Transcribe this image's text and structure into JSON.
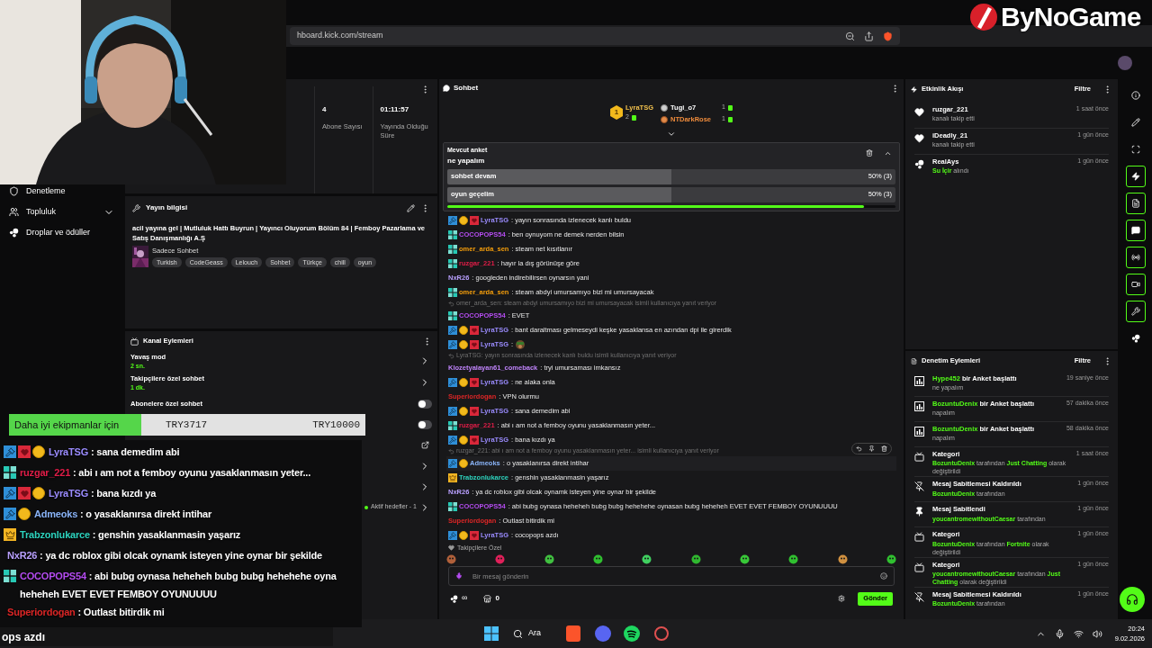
{
  "logo": {
    "text": "ByNoGame"
  },
  "browser": {
    "url": "hboard.kick.com/stream"
  },
  "sidebar": {
    "items": [
      {
        "label": "Denetleme"
      },
      {
        "label": "Topluluk",
        "expanded": true
      },
      {
        "label": "Droplar ve ödüller"
      }
    ]
  },
  "stats": [
    {
      "value": "4",
      "label": "Abone Sayısı"
    },
    {
      "value": "01:11:57",
      "label": "Yayında Olduğu Süre"
    }
  ],
  "stream_info": {
    "title": "Yayın bilgisi",
    "stream_title": "acil yayına gel | Mutluluk Hattı Buyrun | Yayıncı Oluyorum Bölüm 84 | Femboy Pazarlama ve Satış Danışmanlığı A.Ş",
    "category": "Sadece Sohbet",
    "tags": [
      "Turkish",
      "CodeGeass",
      "Lelouch",
      "Sohbet",
      "Türkçe",
      "chill",
      "oyun"
    ]
  },
  "channel_actions": {
    "title": "Kanal Eylemleri",
    "items": [
      {
        "kind": "chevron",
        "label": "Yavaş mod",
        "value": "2 sn."
      },
      {
        "kind": "chevron",
        "label": "Takipçilere özel sohbet",
        "value": "1 dk."
      },
      {
        "kind": "toggle",
        "label": "Abonelere özel sohbet",
        "on": false
      },
      {
        "kind": "toggle",
        "on": false
      },
      {
        "kind": "external"
      },
      {
        "kind": "chevron"
      },
      {
        "kind": "chevron"
      },
      {
        "kind": "chevron",
        "status": "Aktif hedefler - 1"
      }
    ]
  },
  "chat": {
    "title": "Sohbet",
    "leaders": [
      {
        "kind": "gold",
        "rank": "1",
        "name": "LyraTSG",
        "count": "2",
        "color": "#f2c14e"
      },
      {
        "kind": "silver",
        "name": "Tugi_o7",
        "count": "1",
        "color": "#ffffff"
      },
      {
        "kind": "bronze",
        "name": "NTDarkRose",
        "count": "1",
        "color": "#f08c3c"
      }
    ],
    "poll": {
      "label": "Mevcut anket",
      "question": "ne yapalım",
      "level": 0.93,
      "options": [
        {
          "text": "sohbet devam",
          "result": "50% (3)",
          "level": 0.5
        },
        {
          "text": "oyun geçelim",
          "result": "50% (3)",
          "level": 0.5
        }
      ]
    },
    "messages": [
      {
        "kind": "message",
        "badges": [
          {
            "kind": "mod"
          },
          {
            "kind": "sub"
          },
          {
            "kind": "vip"
          }
        ],
        "name": "LyraTSG",
        "color": "#9b8cff",
        "text": ": yayın sonrasında izlenecek kanlı buldu"
      },
      {
        "kind": "message",
        "badges": [
          {
            "kind": "og"
          }
        ],
        "name": "COCOPOPS54",
        "color": "#b44cf0",
        "text": ": ben oynuyom ne demek nerden bilsin"
      },
      {
        "kind": "message",
        "badges": [
          {
            "kind": "og"
          }
        ],
        "name": "omer_arda_sen",
        "color": "#f59e0b",
        "text": ": steam net kısıtlanır"
      },
      {
        "kind": "message",
        "badges": [
          {
            "kind": "og"
          }
        ],
        "name": "ruzgar_221",
        "color": "#e11d48",
        "text": ": hayır la dış görünüşe göre"
      },
      {
        "kind": "message",
        "name": "NxR26",
        "color": "#b9a0ff",
        "text": ": googleden indirebilirsen oynarsın yani"
      },
      {
        "kind": "message",
        "badges": [
          {
            "kind": "og"
          }
        ],
        "name": "omer_arda_sen",
        "color": "#f59e0b",
        "text": ": steam abdyi umursamıyo bizi mi umursayacak"
      },
      {
        "kind": "reply",
        "text": "omer_arda_sen: steam abdyi umursamıyo bizi mi umursayacak isimli kullanıcıya yanıt veriyor"
      },
      {
        "kind": "message",
        "badges": [
          {
            "kind": "og"
          }
        ],
        "name": "COCOPOPS54",
        "color": "#b44cf0",
        "text": ": EVET"
      },
      {
        "kind": "message",
        "badges": [
          {
            "kind": "mod"
          },
          {
            "kind": "sub"
          },
          {
            "kind": "vip"
          }
        ],
        "name": "LyraTSG",
        "color": "#9b8cff",
        "text": ": bant daraltması gelmeseydi keşke yasaklansa en azından dpi ile girerdik"
      },
      {
        "kind": "message",
        "badges": [
          {
            "kind": "mod"
          },
          {
            "kind": "sub"
          },
          {
            "kind": "vip"
          }
        ],
        "name": "LyraTSG",
        "color": "#9b8cff",
        "text": ":",
        "emote": true
      },
      {
        "kind": "reply",
        "text": "LyraTSG: yayın sonrasında izlenecek kanlı buldu isimli kullanıcıya yanıt veriyor"
      },
      {
        "kind": "message",
        "name": "Klozetyalayan61_comeback",
        "color": "#c084fc",
        "text": ": tryi umursaması imkansız"
      },
      {
        "kind": "message",
        "badges": [
          {
            "kind": "mod"
          },
          {
            "kind": "sub"
          },
          {
            "kind": "vip"
          }
        ],
        "name": "LyraTSG",
        "color": "#9b8cff",
        "text": ": ne alaka onla"
      },
      {
        "kind": "message",
        "name": "Superiordogan",
        "color": "#dc2626",
        "text": ": VPN olurmu"
      },
      {
        "kind": "message",
        "badges": [
          {
            "kind": "mod"
          },
          {
            "kind": "sub"
          },
          {
            "kind": "vip"
          }
        ],
        "name": "LyraTSG",
        "color": "#9b8cff",
        "text": ": sana demedim abi"
      },
      {
        "kind": "message",
        "badges": [
          {
            "kind": "og"
          }
        ],
        "name": "ruzgar_221",
        "color": "#e11d48",
        "text": ": abi ı am not a femboy oyunu yasaklanmasın yeter..."
      },
      {
        "kind": "message",
        "badges": [
          {
            "kind": "mod"
          },
          {
            "kind": "sub"
          },
          {
            "kind": "vip"
          }
        ],
        "name": "LyraTSG",
        "color": "#9b8cff",
        "text": ": bana kızdı ya"
      },
      {
        "kind": "reply",
        "text": "ruzgar_221: abi ı am not a femboy oyunu yasaklanmasın yeter... isimli kullanıcıya yanıt veriyor"
      },
      {
        "kind": "message",
        "badges": [
          {
            "kind": "mod"
          },
          {
            "kind": "sub"
          }
        ],
        "name": "Admeoks",
        "color": "#8ab4f8",
        "text": ": o yasaklanırsa direkt intihar",
        "hovered": true
      },
      {
        "kind": "message",
        "badges": [
          {
            "kind": "crown"
          }
        ],
        "name": "Trabzonlukarce",
        "color": "#2dd4bf",
        "text": ": genshin yasaklanmasin yaşarız"
      },
      {
        "kind": "message",
        "name": "NxR26",
        "color": "#b9a0ff",
        "text": ": ya dc roblox gibi olcak oynamk isteyen yine oynar bir şekilde"
      },
      {
        "kind": "message",
        "badges": [
          {
            "kind": "og"
          }
        ],
        "name": "COCOPOPS54",
        "color": "#b44cf0",
        "text": ": abi bubg oynasa heheheh bubg bubg hehehehe oynasan bubg heheheh EVET EVET FEMBOY OYUNUUUU"
      },
      {
        "kind": "message",
        "name": "Superiordogan",
        "color": "#dc2626",
        "text": ": Outlast bitirdik mi"
      },
      {
        "kind": "message",
        "badges": [
          {
            "kind": "mod"
          },
          {
            "kind": "sub"
          },
          {
            "kind": "vip"
          }
        ],
        "name": "LyraTSG",
        "color": "#9b8cff",
        "text": ": cocopops azdı"
      }
    ],
    "emote_section": "Takipçilere Özel",
    "input": {
      "placeholder": "Bir mesaj gönderin"
    },
    "points": "∞",
    "shop_count": "0",
    "send": "Gönder"
  },
  "activity": {
    "title": "Etkinlik Akışı",
    "filter": "Filtre",
    "items": [
      {
        "kind": "follow",
        "name": "ruzgar_221",
        "time": "1 saat önce",
        "detail": "kanalı takip etti"
      },
      {
        "kind": "follow",
        "name": "iDeadly_21",
        "time": "1 gün önce",
        "detail": "kanalı takip etti"
      },
      {
        "kind": "reward",
        "name": "RealAys",
        "time": "1 gün önce",
        "detail": "**Su İçir** alındı"
      }
    ]
  },
  "moderation": {
    "title": "Denetim Eylemleri",
    "filter": "Filtre",
    "items": [
      {
        "kind": "poll",
        "time": "19 saniye önce",
        "title": "**Hype452** bir Anket başlattı",
        "detail": "ne yapalım"
      },
      {
        "kind": "poll",
        "time": "57 dakika önce",
        "title": "**BozuntuDenix** bir Anket başlattı",
        "detail": "napalım"
      },
      {
        "kind": "poll",
        "time": "58 dakika önce",
        "title": "**BozuntuDenix** bir Anket başlattı",
        "detail": "napalım"
      },
      {
        "kind": "category",
        "time": "1 saat önce",
        "title": "Kategori",
        "detail": "**BozuntuDenix** tarafından **Just Chatting** olarak değiştirildi"
      },
      {
        "kind": "unpin",
        "time": "1 gün önce",
        "title": "Mesaj Sabitlemesi Kaldırıldı",
        "detail": "**BozuntuDenix** tarafından"
      },
      {
        "kind": "pin",
        "time": "1 gün önce",
        "title": "Mesaj Sabitlendi",
        "detail": "**youcantromewithoutCaesar** tarafından"
      },
      {
        "kind": "category",
        "time": "1 gün önce",
        "title": "Kategori",
        "detail": "**BozuntuDenix** tarafından **Fortnite** olarak değiştirildi"
      },
      {
        "kind": "category",
        "time": "1 gün önce",
        "title": "Kategori",
        "detail": "**youcantromewithoutCaesar** tarafından **Just Chatting** olarak değiştirildi"
      },
      {
        "kind": "unpin",
        "time": "1 gün önce",
        "title": "Mesaj Sabitlemesi Kaldırıldı",
        "detail": "**BozuntuDenix** tarafından"
      }
    ]
  },
  "rail": [
    {
      "on": false
    },
    {
      "on": false
    },
    {
      "on": false
    },
    {
      "on": true
    },
    {
      "on": true
    },
    {
      "on": true
    },
    {
      "on": true
    },
    {
      "on": true
    },
    {
      "on": true
    },
    {
      "on": false
    }
  ],
  "overlay": {
    "goal": {
      "label": "Daha iyi ekipmanlar için",
      "current": "TRY3717",
      "target": "TRY10000",
      "level": 0.37
    },
    "messages": [
      {
        "badges": [
          {
            "kind": "mod"
          },
          {
            "kind": "vip"
          },
          {
            "kind": "sub"
          }
        ],
        "name": "LyraTSG",
        "color": "#9b8cff",
        "text": ": sana demedim abi"
      },
      {
        "badges": [
          {
            "kind": "og"
          }
        ],
        "name": "ruzgar_221",
        "color": "#e11d48",
        "text": ": abi ı am not a femboy oyunu yasaklanmasın yeter..."
      },
      {
        "badges": [
          {
            "kind": "mod"
          },
          {
            "kind": "vip"
          },
          {
            "kind": "sub"
          }
        ],
        "name": "LyraTSG",
        "color": "#9b8cff",
        "text": ": bana kızdı ya"
      },
      {
        "badges": [
          {
            "kind": "mod"
          },
          {
            "kind": "sub"
          }
        ],
        "name": "Admeoks",
        "color": "#8ab4f8",
        "text": ": o yasaklanırsa direkt intihar"
      },
      {
        "badges": [
          {
            "kind": "crown"
          }
        ],
        "name": "Trabzonlukarce",
        "color": "#2dd4bf",
        "text": ": genshin yasaklanmasin yaşarız"
      },
      {
        "name": "NxR26",
        "color": "#b9a0ff",
        "text": ": ya dc roblox gibi olcak oynamk isteyen yine oynar bir şekilde"
      },
      {
        "badges": [
          {
            "kind": "og"
          }
        ],
        "name": "COCOPOPS54",
        "color": "#b44cf0",
        "text": ": abi bubg oynasa heheheh bubg bubg hehehehe oyna heheheh EVET EVET FEMBOY OYUNUUUU"
      },
      {
        "name": "Superiordogan",
        "color": "#dc2626",
        "text": ": Outlast bitirdik mi"
      }
    ],
    "cut_line": "ops azdı"
  },
  "taskbar": {
    "search": "Ara",
    "time": "20:24",
    "date": "9.02.2026"
  }
}
